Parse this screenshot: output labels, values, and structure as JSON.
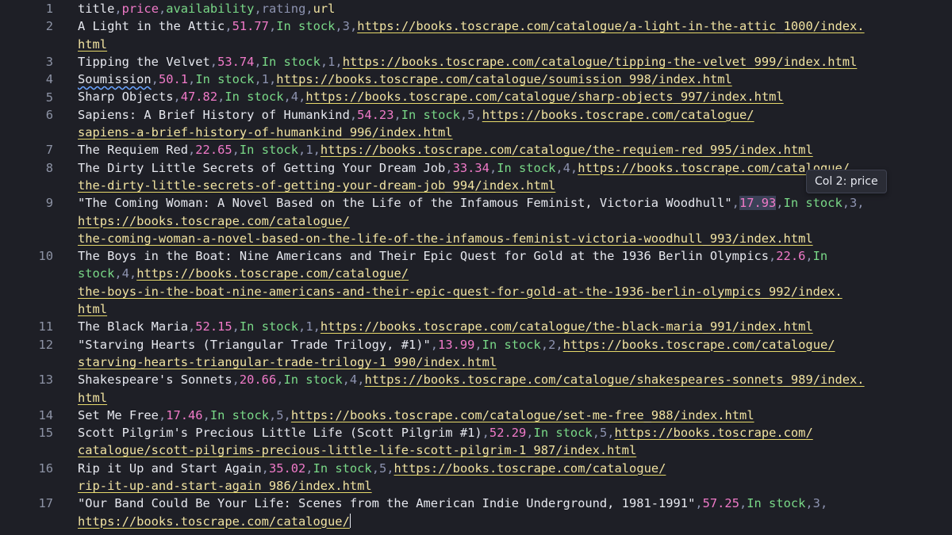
{
  "editor": {
    "lines": [
      {
        "n": "1",
        "rows": [
          [
            [
              "title",
              "c-head-title"
            ],
            [
              ",",
              "comma"
            ],
            [
              "price",
              "c-head-price"
            ],
            [
              ",",
              "comma"
            ],
            [
              "availability",
              "c-head-avail"
            ],
            [
              ",",
              "comma"
            ],
            [
              "rating",
              "c-head-rating"
            ],
            [
              ",",
              "comma"
            ],
            [
              "url",
              "c-head-url"
            ]
          ]
        ]
      },
      {
        "n": "2",
        "rows": [
          [
            [
              "A Light in the Attic",
              "c-text"
            ],
            [
              ",",
              "comma"
            ],
            [
              "51.77",
              "c-price"
            ],
            [
              ",",
              "comma"
            ],
            [
              "In stock",
              "c-avail"
            ],
            [
              ",",
              "comma"
            ],
            [
              "3",
              "c-rating"
            ],
            [
              ",",
              "comma"
            ],
            [
              "https://books.toscrape.com/catalogue/a-light-in-the-attic_1000/index.",
              "c-url"
            ]
          ],
          [
            [
              "html",
              "c-url"
            ]
          ]
        ]
      },
      {
        "n": "3",
        "rows": [
          [
            [
              "Tipping the Velvet",
              "c-text"
            ],
            [
              ",",
              "comma"
            ],
            [
              "53.74",
              "c-price"
            ],
            [
              ",",
              "comma"
            ],
            [
              "In stock",
              "c-avail"
            ],
            [
              ",",
              "comma"
            ],
            [
              "1",
              "c-rating"
            ],
            [
              ",",
              "comma"
            ],
            [
              "https://books.toscrape.com/catalogue/tipping-the-velvet_999/index.html",
              "c-url"
            ]
          ]
        ]
      },
      {
        "n": "4",
        "rows": [
          [
            [
              "Soumission",
              "c-text squiggle"
            ],
            [
              ",",
              "comma"
            ],
            [
              "50.1",
              "c-price"
            ],
            [
              ",",
              "comma"
            ],
            [
              "In stock",
              "c-avail"
            ],
            [
              ",",
              "comma"
            ],
            [
              "1",
              "c-rating"
            ],
            [
              ",",
              "comma"
            ],
            [
              "https://books.toscrape.com/catalogue/soumission_998/index.html",
              "c-url"
            ]
          ]
        ]
      },
      {
        "n": "5",
        "rows": [
          [
            [
              "Sharp Objects",
              "c-text"
            ],
            [
              ",",
              "comma"
            ],
            [
              "47.82",
              "c-price"
            ],
            [
              ",",
              "comma"
            ],
            [
              "In stock",
              "c-avail"
            ],
            [
              ",",
              "comma"
            ],
            [
              "4",
              "c-rating"
            ],
            [
              ",",
              "comma"
            ],
            [
              "https://books.toscrape.com/catalogue/sharp-objects_997/index.html",
              "c-url"
            ]
          ]
        ]
      },
      {
        "n": "6",
        "rows": [
          [
            [
              "Sapiens: A Brief History of Humankind",
              "c-text"
            ],
            [
              ",",
              "comma"
            ],
            [
              "54.23",
              "c-price"
            ],
            [
              ",",
              "comma"
            ],
            [
              "In stock",
              "c-avail"
            ],
            [
              ",",
              "comma"
            ],
            [
              "5",
              "c-rating"
            ],
            [
              ",",
              "comma"
            ],
            [
              "https://books.toscrape.com/catalogue/",
              "c-url"
            ]
          ],
          [
            [
              "sapiens-a-brief-history-of-humankind_996/index.html",
              "c-url"
            ]
          ]
        ]
      },
      {
        "n": "7",
        "rows": [
          [
            [
              "The Requiem Red",
              "c-text"
            ],
            [
              ",",
              "comma"
            ],
            [
              "22.65",
              "c-price"
            ],
            [
              ",",
              "comma"
            ],
            [
              "In stock",
              "c-avail"
            ],
            [
              ",",
              "comma"
            ],
            [
              "1",
              "c-rating"
            ],
            [
              ",",
              "comma"
            ],
            [
              "https://books.toscrape.com/catalogue/the-requiem-red_995/index.html",
              "c-url"
            ]
          ]
        ]
      },
      {
        "n": "8",
        "rows": [
          [
            [
              "The Dirty Little Secrets of Getting Your Dream Job",
              "c-text"
            ],
            [
              ",",
              "comma"
            ],
            [
              "33.34",
              "c-price"
            ],
            [
              ",",
              "comma"
            ],
            [
              "In stock",
              "c-avail"
            ],
            [
              ",",
              "comma"
            ],
            [
              "4",
              "c-rating"
            ],
            [
              ",",
              "comma"
            ],
            [
              "https://books.toscrape.com/catalogue/",
              "c-url"
            ]
          ],
          [
            [
              "the-dirty-little-secrets-of-getting-your-dream-job_994/index.html",
              "c-url"
            ]
          ]
        ]
      },
      {
        "n": "9",
        "rows": [
          [
            [
              "\"The Coming Woman: A Novel Based on the Life of the Infamous Feminist, Victoria Woodhull\"",
              "c-text"
            ],
            [
              ",",
              "comma"
            ],
            [
              "17.93",
              "c-price sel"
            ],
            [
              ",",
              "comma"
            ],
            [
              "In stock",
              "c-avail"
            ],
            [
              ",",
              "comma"
            ],
            [
              "3",
              "c-rating"
            ],
            [
              ",",
              "comma"
            ]
          ],
          [
            [
              "https://books.toscrape.com/catalogue/",
              "c-url"
            ]
          ],
          [
            [
              "the-coming-woman-a-novel-based-on-the-life-of-the-infamous-feminist-victoria-woodhull_993/index.html",
              "c-url"
            ]
          ]
        ]
      },
      {
        "n": "10",
        "rows": [
          [
            [
              "The Boys in the Boat: Nine Americans and Their Epic Quest for Gold at the 1936 Berlin Olympics",
              "c-text"
            ],
            [
              ",",
              "comma"
            ],
            [
              "22.6",
              "c-price"
            ],
            [
              ",",
              "comma"
            ],
            [
              "In",
              "c-avail"
            ]
          ],
          [
            [
              "stock",
              "c-avail"
            ],
            [
              ",",
              "comma"
            ],
            [
              "4",
              "c-rating"
            ],
            [
              ",",
              "comma"
            ],
            [
              "https://books.toscrape.com/catalogue/",
              "c-url"
            ]
          ],
          [
            [
              "the-boys-in-the-boat-nine-americans-and-their-epic-quest-for-gold-at-the-1936-berlin-olympics_992/index.",
              "c-url"
            ]
          ],
          [
            [
              "html",
              "c-url"
            ]
          ]
        ]
      },
      {
        "n": "11",
        "rows": [
          [
            [
              "The Black Maria",
              "c-text"
            ],
            [
              ",",
              "comma"
            ],
            [
              "52.15",
              "c-price"
            ],
            [
              ",",
              "comma"
            ],
            [
              "In stock",
              "c-avail"
            ],
            [
              ",",
              "comma"
            ],
            [
              "1",
              "c-rating"
            ],
            [
              ",",
              "comma"
            ],
            [
              "https://books.toscrape.com/catalogue/the-black-maria_991/index.html",
              "c-url"
            ]
          ]
        ]
      },
      {
        "n": "12",
        "rows": [
          [
            [
              "\"Starving Hearts (Triangular Trade Trilogy, #1)\"",
              "c-text"
            ],
            [
              ",",
              "comma"
            ],
            [
              "13.99",
              "c-price"
            ],
            [
              ",",
              "comma"
            ],
            [
              "In stock",
              "c-avail"
            ],
            [
              ",",
              "comma"
            ],
            [
              "2",
              "c-rating"
            ],
            [
              ",",
              "comma"
            ],
            [
              "https://books.toscrape.com/catalogue/",
              "c-url"
            ]
          ],
          [
            [
              "starving-hearts-triangular-trade-trilogy-1_990/index.html",
              "c-url"
            ]
          ]
        ]
      },
      {
        "n": "13",
        "rows": [
          [
            [
              "Shakespeare's Sonnets",
              "c-text"
            ],
            [
              ",",
              "comma"
            ],
            [
              "20.66",
              "c-price"
            ],
            [
              ",",
              "comma"
            ],
            [
              "In stock",
              "c-avail"
            ],
            [
              ",",
              "comma"
            ],
            [
              "4",
              "c-rating"
            ],
            [
              ",",
              "comma"
            ],
            [
              "https://books.toscrape.com/catalogue/shakespeares-sonnets_989/index.",
              "c-url"
            ]
          ],
          [
            [
              "html",
              "c-url"
            ]
          ]
        ]
      },
      {
        "n": "14",
        "rows": [
          [
            [
              "Set Me Free",
              "c-text"
            ],
            [
              ",",
              "comma"
            ],
            [
              "17.46",
              "c-price"
            ],
            [
              ",",
              "comma"
            ],
            [
              "In stock",
              "c-avail"
            ],
            [
              ",",
              "comma"
            ],
            [
              "5",
              "c-rating"
            ],
            [
              ",",
              "comma"
            ],
            [
              "https://books.toscrape.com/catalogue/set-me-free_988/index.html",
              "c-url"
            ]
          ]
        ]
      },
      {
        "n": "15",
        "rows": [
          [
            [
              "Scott Pilgrim's Precious Little Life (Scott Pilgrim #1)",
              "c-text"
            ],
            [
              ",",
              "comma"
            ],
            [
              "52.29",
              "c-price"
            ],
            [
              ",",
              "comma"
            ],
            [
              "In stock",
              "c-avail"
            ],
            [
              ",",
              "comma"
            ],
            [
              "5",
              "c-rating"
            ],
            [
              ",",
              "comma"
            ],
            [
              "https://books.toscrape.com/",
              "c-url"
            ]
          ],
          [
            [
              "catalogue/scott-pilgrims-precious-little-life-scott-pilgrim-1_987/index.html",
              "c-url"
            ]
          ]
        ]
      },
      {
        "n": "16",
        "rows": [
          [
            [
              "Rip it Up and Start Again",
              "c-text"
            ],
            [
              ",",
              "comma"
            ],
            [
              "35.02",
              "c-price"
            ],
            [
              ",",
              "comma"
            ],
            [
              "In stock",
              "c-avail"
            ],
            [
              ",",
              "comma"
            ],
            [
              "5",
              "c-rating"
            ],
            [
              ",",
              "comma"
            ],
            [
              "https://books.toscrape.com/catalogue/",
              "c-url"
            ]
          ],
          [
            [
              "rip-it-up-and-start-again_986/index.html",
              "c-url"
            ]
          ]
        ]
      },
      {
        "n": "17",
        "rows": [
          [
            [
              "\"Our Band Could Be Your Life: Scenes from the American Indie Underground, 1981-1991\"",
              "c-text"
            ],
            [
              ",",
              "comma"
            ],
            [
              "57.25",
              "c-price"
            ],
            [
              ",",
              "comma"
            ],
            [
              "In stock",
              "c-avail"
            ],
            [
              ",",
              "comma"
            ],
            [
              "3",
              "c-rating"
            ],
            [
              ",",
              "comma"
            ]
          ],
          [
            [
              "https://books.toscrape.com/catalogue/",
              "c-url"
            ],
            [
              "|",
              "cursor-mark"
            ]
          ]
        ]
      }
    ]
  },
  "tooltip": {
    "label": "Col 2: price"
  },
  "colors": {
    "background": "#1e1f26",
    "text": "#e6e8ef",
    "price": "#f07ac8",
    "availability": "#79d887",
    "rating": "#8d93b0",
    "url": "#f1e3a1",
    "line_number": "#8d93a5"
  }
}
